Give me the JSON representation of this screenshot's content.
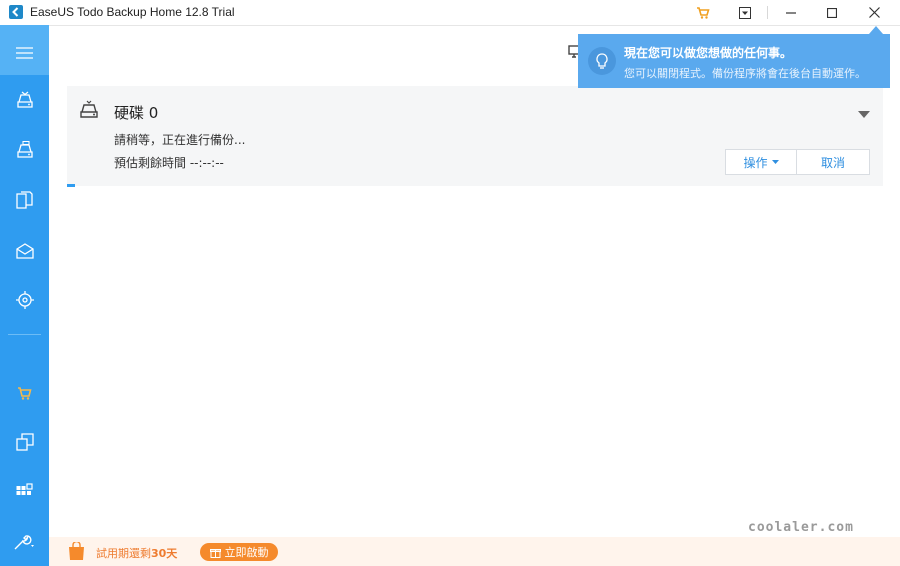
{
  "window": {
    "title": "EaseUS Todo Backup Home 12.8 Trial",
    "controls": [
      "cart-icon",
      "menu-dropdown-icon",
      "minimize-icon",
      "maximize-icon",
      "close-icon"
    ]
  },
  "sidebar": {
    "items": [
      {
        "icon": "menu-icon"
      },
      {
        "icon": "disk-backup-icon"
      },
      {
        "icon": "system-backup-icon"
      },
      {
        "icon": "file-backup-icon"
      },
      {
        "icon": "mail-backup-icon"
      },
      {
        "icon": "smart-backup-icon"
      },
      {
        "icon": "cart-icon"
      },
      {
        "icon": "clone-icon"
      },
      {
        "icon": "tools-icon"
      },
      {
        "icon": "settings-icon"
      }
    ]
  },
  "task": {
    "title": "硬碟 0",
    "status": "請稍等，正在進行備份...",
    "remaining": "預估剩餘時間 --:--:--",
    "ops_label": "操作",
    "cancel_label": "取消",
    "progress_fraction": 0.01
  },
  "notification": {
    "title": "現在您可以做您想做的任何事。",
    "body": "您可以關閉程式。備份程序將會在後台自動運作。"
  },
  "trial": {
    "text_prefix": "試用期還剩",
    "days": "30天",
    "activate_label": "立即啟動"
  },
  "watermark": "coolaler.com",
  "colors": {
    "accent": "#2f9cf0",
    "sidebar": "#2f9cf0",
    "notification": "#5aa9ee",
    "trial": "#f58a2c"
  }
}
